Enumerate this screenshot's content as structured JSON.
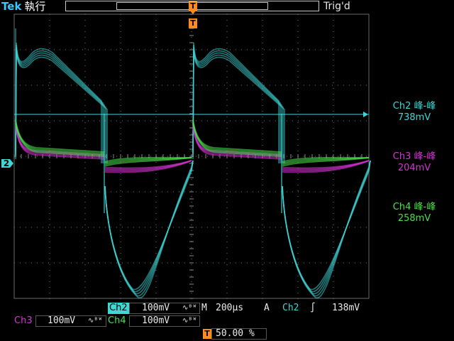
{
  "header": {
    "brand": "Tek",
    "status": "執行",
    "trigger_state": "Trig'd"
  },
  "trigger_marker": "T",
  "ground_marker": "2",
  "measurements": [
    {
      "channel": "Ch2",
      "label": "峰-峰",
      "value": "738mV",
      "color": "#3fd6d6"
    },
    {
      "channel": "Ch3",
      "label": "峰-峰",
      "value": "204mV",
      "color": "#d633d6"
    },
    {
      "channel": "Ch4",
      "label": "峰-峰",
      "value": "258mV",
      "color": "#4ddf4d"
    }
  ],
  "channels": {
    "ch2": {
      "name": "Ch2",
      "scale": "100mV",
      "bw": "∿ᴮᵂ",
      "color": "#3fd6d6"
    },
    "ch3": {
      "name": "Ch3",
      "scale": "100mV",
      "bw": "∿ᴮᵂ",
      "color": "#d633d6"
    },
    "ch4": {
      "name": "Ch4",
      "scale": "100mV",
      "bw": "∿ᴮᵂ",
      "color": "#4ddf4d"
    }
  },
  "timebase": {
    "label": "M",
    "value": "200µs"
  },
  "trigger": {
    "mode": "A",
    "source": "Ch2",
    "slope": "∫",
    "level": "138mV"
  },
  "trigger_position": {
    "marker": "T",
    "value": "50.00 %"
  }
}
